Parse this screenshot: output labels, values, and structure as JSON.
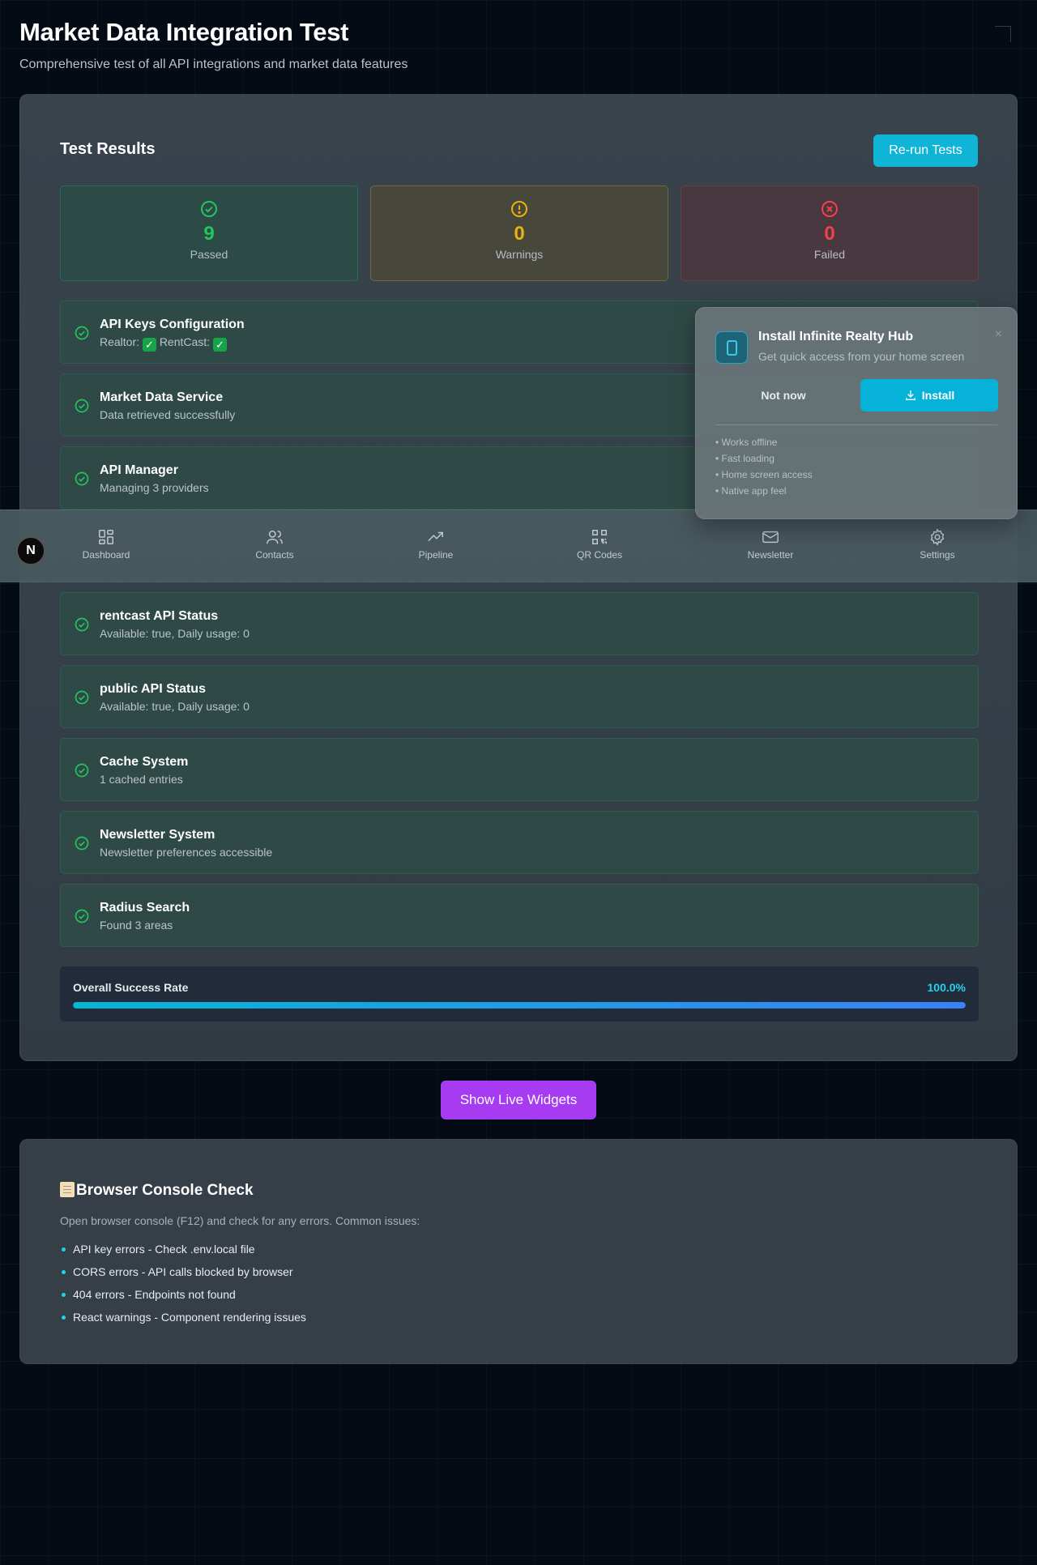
{
  "header": {
    "title": "Market Data Integration Test",
    "subtitle": "Comprehensive test of all API integrations and market data features"
  },
  "results": {
    "title": "Test Results",
    "rerun_label": "Re-run Tests",
    "stats": {
      "passed": {
        "count": "9",
        "label": "Passed",
        "color": "#22c55e"
      },
      "warnings": {
        "count": "0",
        "label": "Warnings",
        "color": "#eab308"
      },
      "failed": {
        "count": "0",
        "label": "Failed",
        "color": "#ef4444"
      }
    },
    "tests": [
      {
        "name": "API Keys Configuration",
        "detail_prefix": "Realtor:",
        "detail_middle": "RentCast:"
      },
      {
        "name": "Market Data Service",
        "detail": "Data retrieved successfully"
      },
      {
        "name": "API Manager",
        "detail": "Managing 3 providers"
      },
      {
        "name": "rentcast API Status",
        "detail": "Available: true, Daily usage: 0"
      },
      {
        "name": "public API Status",
        "detail": "Available: true, Daily usage: 0"
      },
      {
        "name": "Cache System",
        "detail": "1 cached entries"
      },
      {
        "name": "Newsletter System",
        "detail": "Newsletter preferences accessible"
      },
      {
        "name": "Radius Search",
        "detail": "Found 3 areas"
      }
    ],
    "success_rate": {
      "label": "Overall Success Rate",
      "value_text": "100.0%",
      "fraction": 1.0
    }
  },
  "widgets_button": "Show Live Widgets",
  "console": {
    "title": "Browser Console Check",
    "description": "Open browser console (F12) and check for any errors. Common issues:",
    "items": [
      "API key errors - Check .env.local file",
      "CORS errors - API calls blocked by browser",
      "404 errors - Endpoints not found",
      "React warnings - Component rendering issues"
    ]
  },
  "nav": {
    "items": [
      {
        "label": "Dashboard",
        "icon": "dashboard-icon"
      },
      {
        "label": "Contacts",
        "icon": "contacts-icon"
      },
      {
        "label": "Pipeline",
        "icon": "pipeline-icon"
      },
      {
        "label": "QR Codes",
        "icon": "qr-code-icon"
      },
      {
        "label": "Newsletter",
        "icon": "mail-icon"
      },
      {
        "label": "Settings",
        "icon": "gear-icon"
      }
    ]
  },
  "next_badge": "N",
  "install_popup": {
    "title": "Install Infinite Realty Hub",
    "subtitle": "Get quick access from your home screen",
    "close_symbol": "×",
    "not_now_label": "Not now",
    "install_label": "Install",
    "features": [
      "• Works offline",
      "• Fast loading",
      "• Home screen access",
      "• Native app feel"
    ]
  },
  "colors": {
    "accent": "#0fb4d6",
    "purple": "#a63bf2",
    "success": "#22c55e"
  }
}
